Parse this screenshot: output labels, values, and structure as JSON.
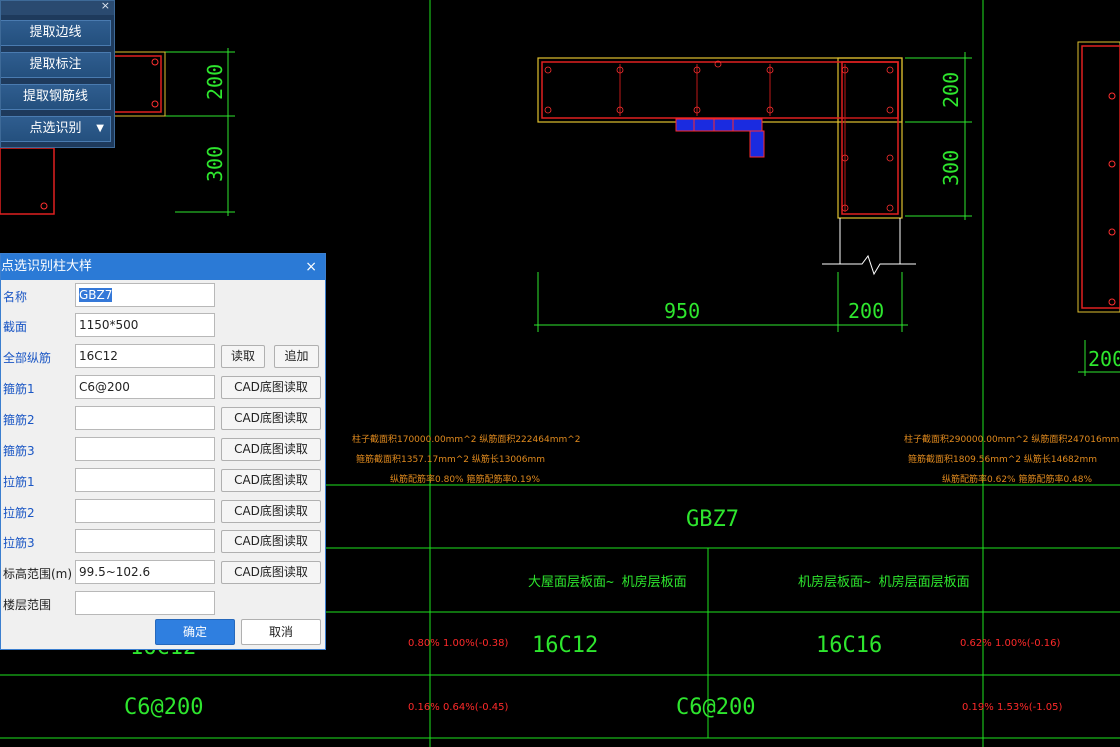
{
  "toolbar": {
    "close_label": "×",
    "buttons": [
      "提取边线",
      "提取标注",
      "提取钢筋线",
      "点选识别"
    ],
    "dropdown_arrow": "▼"
  },
  "dialog": {
    "title": "点选识别柱大样",
    "close_label": "×",
    "rows": [
      {
        "label": "名称",
        "value": "GBZ7"
      },
      {
        "label": "截面",
        "value": "1150*500"
      },
      {
        "label": "全部纵筋",
        "value": "16C12",
        "buttons": [
          "读取",
          "追加"
        ]
      },
      {
        "label": "箍筋1",
        "value": "C6@200",
        "buttons": [
          "CAD底图读取"
        ]
      },
      {
        "label": "箍筋2",
        "value": "",
        "buttons": [
          "CAD底图读取"
        ]
      },
      {
        "label": "箍筋3",
        "value": "",
        "buttons": [
          "CAD底图读取"
        ]
      },
      {
        "label": "拉筋1",
        "value": "",
        "buttons": [
          "CAD底图读取"
        ]
      },
      {
        "label": "拉筋2",
        "value": "",
        "buttons": [
          "CAD底图读取"
        ]
      },
      {
        "label": "拉筋3",
        "value": "",
        "buttons": [
          "CAD底图读取"
        ]
      },
      {
        "label": "标高范围(m)",
        "value": "99.5~102.6",
        "buttons": [
          "CAD底图读取"
        ]
      },
      {
        "label": "楼层范围",
        "value": ""
      }
    ],
    "ok_label": "确定",
    "cancel_label": "取消"
  },
  "drawing": {
    "dims_left": [
      "200",
      "300"
    ],
    "dims_center_v": [
      "200",
      "300"
    ],
    "dims_center_h": [
      "950",
      "200"
    ],
    "dim_right": "200",
    "table_title": "GBZ7",
    "col_headers": [
      "大屋面层板面~ 机房层板面",
      "机房层板面~ 机房层面层板面"
    ],
    "rebar_row": [
      "16C12",
      "16C12",
      "16C16"
    ],
    "stirrup_row": [
      "C6@200",
      "C6@200"
    ],
    "ratios_row1": [
      "0.80% 1.00%(-0.38)",
      "0.62% 1.00%(-0.16)"
    ],
    "ratios_row2": [
      "0.16% 0.64%(-0.45)",
      "0.19% 1.53%(-1.05)"
    ],
    "orange_left": [
      "柱子截面积170000.00mm^2 纵筋面积222464mm^2",
      "箍筋截面积1357.17mm^2 纵筋长13006mm",
      "纵筋配筋率0.80% 箍筋配筋率0.19%"
    ],
    "orange_right": [
      "柱子截面积290000.00mm^2 纵筋面积247016mm^2",
      "箍筋截面积1809.56mm^2 纵筋长14682mm",
      "纵筋配筋率0.62% 箍筋配筋率0.48%"
    ]
  }
}
